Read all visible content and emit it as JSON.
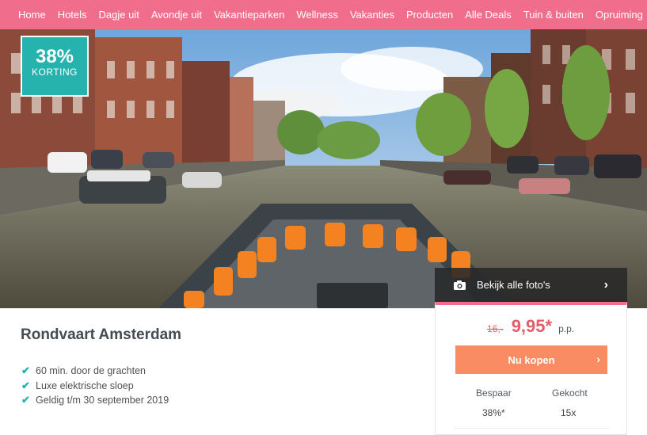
{
  "nav": {
    "items": [
      "Home",
      "Hotels",
      "Dagje uit",
      "Avondje uit",
      "Vakantieparken",
      "Wellness",
      "Vakanties",
      "Producten",
      "Alle Deals",
      "Tuin & buiten",
      "Opruiming"
    ]
  },
  "badge": {
    "percent": "38%",
    "label": "KORTING"
  },
  "photos": {
    "label": "Bekijk alle foto's",
    "icon": "camera-icon"
  },
  "deal": {
    "title": "Rondvaart Amsterdam",
    "features": [
      "60 min. door de grachten",
      "Luxe elektrische sloep",
      "Geldig t/m 30 september 2019"
    ]
  },
  "price": {
    "old": "16,-",
    "new": "9,95*",
    "unit": "p.p.",
    "buy_label": "Nu kopen",
    "savings_label": "Bespaar",
    "savings_value": "38%*",
    "sold_label": "Gekocht",
    "sold_value": "15x"
  },
  "colors": {
    "nav": "#f06e8c",
    "badge": "#27b3ad",
    "price": "#e35d6a",
    "buy": "#f98c63"
  }
}
